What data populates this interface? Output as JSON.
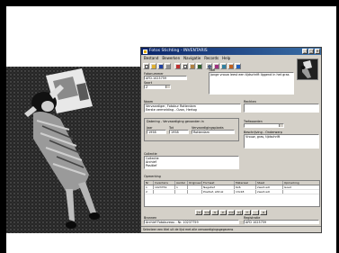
{
  "window": {
    "title": "Fotos Stichting - INVENTARIS",
    "menu": [
      "Bestand",
      "Bewerken",
      "Navigatie",
      "Records",
      "Help"
    ]
  },
  "toolbar": {
    "icons": [
      "new-icon",
      "open-icon",
      "save-icon",
      "print-icon",
      "cut-icon",
      "copy-icon",
      "paste-icon",
      "undo-icon",
      "find-icon",
      "filter-icon",
      "sort-icon",
      "image-icon",
      "help-icon"
    ]
  },
  "form": {
    "nummer_label": "Fotonummer",
    "nummer_value": "AFD.1023759",
    "titel_label": "Titel",
    "titel_value": "Jonge vrouw leest een tijdschrift liggend in het gras",
    "soort_label": "Soort",
    "soort_value": "Z",
    "naam_label": "Naam",
    "naam_value": "Vervaardiger, Fotobur Rotterdam",
    "naam_value2": "Eerste vermelding - Ozon, Hertog",
    "rechten_label": "Rechten",
    "vervaardiging_label": "Datering - Vervaardiging gevonden in",
    "jaar_label": "Jaar",
    "jaar_value": "1958",
    "tot_label": "Tot",
    "tot_value": "1958",
    "plaats_label": "Vervaardigingsplaats",
    "plaats_value": "Rotterdam",
    "trefwoorden_label": "Trefwoorden",
    "beschrijving_label": "Beschrijving - Onderwerp",
    "beschrijving_value": "Vrouw, gras, tijdschrift",
    "collectie_label": "Collectie",
    "collectie_values": [
      "Collectie",
      "Archief",
      "Positief"
    ],
    "opmerking_label": "Opmerking",
    "bronnen_label": "Bronnen",
    "bronnen_value": "Archief Fotobureau - Nr. 10237759",
    "registratie_label": "Registratie",
    "registratie_value": "AFD 1023759"
  },
  "table": {
    "headers": [
      "Nr",
      "Inventaris",
      "Aantal",
      "Origineel",
      "Formaat",
      "Materiaal",
      "Staat",
      "Opmerking"
    ],
    "rows": [
      [
        "1",
        "1023759",
        "1",
        "",
        "Negatief",
        "6x6",
        "zwart-wit",
        "Goed"
      ],
      [
        "2",
        "",
        "",
        "",
        "Positief, afdruk",
        "13x18",
        "zwart-wit",
        ""
      ]
    ]
  },
  "nav": [
    "|<",
    "<<",
    "<",
    ">",
    ">>",
    ">|",
    "+",
    "-",
    "x"
  ],
  "status": "Selecteer een titel uit de lijst met alle vervaardigingsgegevens"
}
